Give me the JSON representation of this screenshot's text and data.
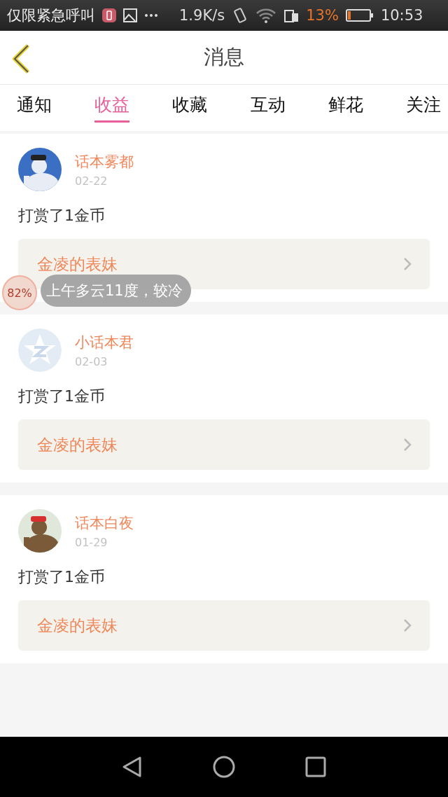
{
  "status_bar": {
    "carrier": "仅限紧急呼叫",
    "speed": "1.9K/s",
    "battery_percent": "13%",
    "time": "10:53"
  },
  "header": {
    "title": "消息"
  },
  "tabs": [
    {
      "label": "通知",
      "selected": false
    },
    {
      "label": "收益",
      "selected": true
    },
    {
      "label": "收藏",
      "selected": false
    },
    {
      "label": "互动",
      "selected": false
    },
    {
      "label": "鲜花",
      "selected": false
    },
    {
      "label": "关注",
      "selected": false
    }
  ],
  "messages": [
    {
      "name": "话本雾都",
      "date": "02-22",
      "text": "打赏了1金币",
      "link": "金凌的表妹"
    },
    {
      "avatar": {
        "kind": "default"
      },
      "name": "小话本君",
      "date": "02-03",
      "text": "打赏了1金币",
      "link": "金凌的表妹"
    },
    {
      "name": "话本白夜",
      "date": "01-29",
      "text": "打赏了1金币",
      "link": "金凌的表妹"
    }
  ],
  "floating_widget": {
    "percent": "82%",
    "weather": "上午多云11度，较冷"
  }
}
